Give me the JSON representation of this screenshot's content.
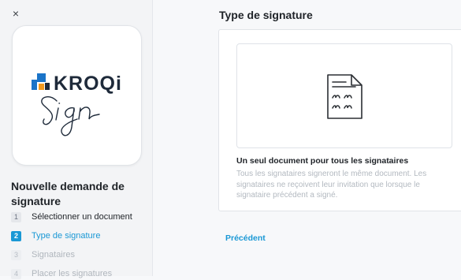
{
  "header": {
    "close_symbol": "×"
  },
  "logo": {
    "brand": "KROQi",
    "sub": "Sign",
    "colors": {
      "blue": "#1a74c8",
      "orange": "#f29a1f",
      "dark": "#1e2a3a"
    }
  },
  "sidebar": {
    "title": "Nouvelle demande de signature",
    "steps": [
      {
        "num": "1",
        "label": "Sélectionner un document",
        "state": "done"
      },
      {
        "num": "2",
        "label": "Type de signature",
        "state": "active"
      },
      {
        "num": "3",
        "label": "Signataires",
        "state": "todo"
      },
      {
        "num": "4",
        "label": "Placer les signatures",
        "state": "todo"
      }
    ]
  },
  "main": {
    "title": "Type de signature",
    "option": {
      "icon": "document-signature-icon",
      "title": "Un seul document pour tous les signataires",
      "description": "Tous les signataires signeront le même document. Les signataires ne reçoivent leur invitation que lorsque le signataire précédent a signé."
    },
    "previous_label": "Précédent"
  },
  "colors": {
    "accent": "#1a98d5",
    "muted": "#b3b9c0"
  }
}
